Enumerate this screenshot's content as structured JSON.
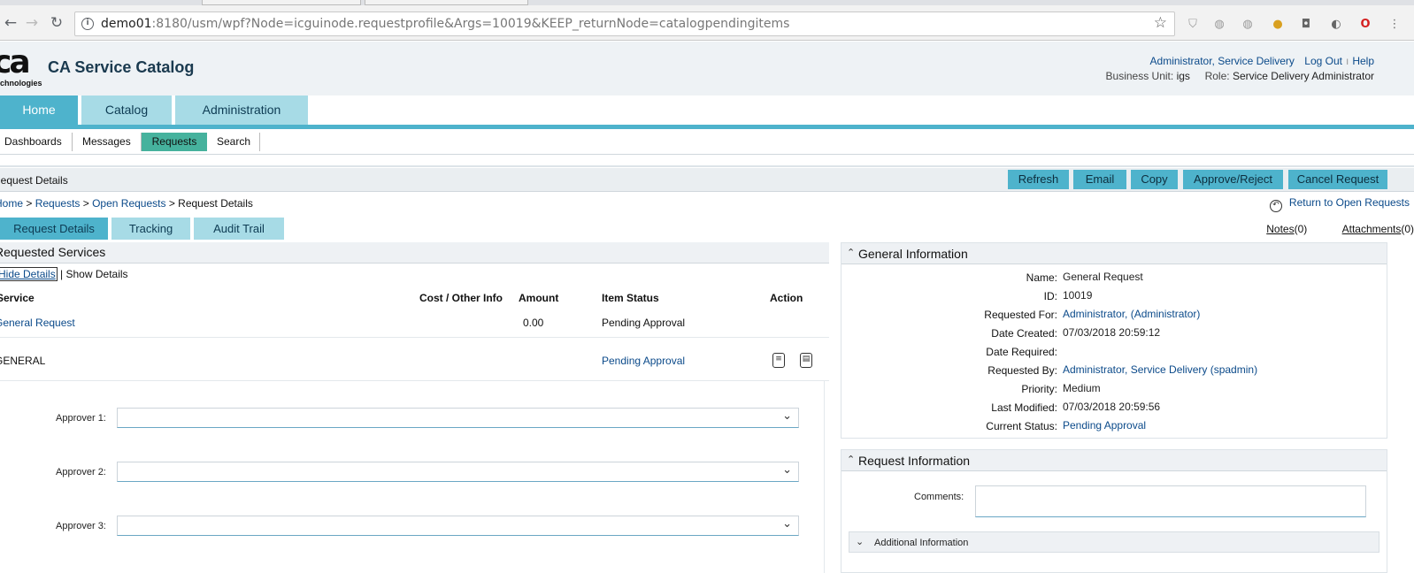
{
  "browser": {
    "url_host": "demo01",
    "url_rest": ":8180/usm/wpf?Node=icguinode.requestprofile&Args=10019&KEEP_returnNode=catalogpendingitems",
    "icons": [
      "back-icon",
      "forward-icon",
      "reload-icon",
      "info-icon",
      "star-icon"
    ]
  },
  "header": {
    "logo_text": "ca",
    "logo_sub": "technologies",
    "title": "CA Service Catalog",
    "user_link": "Administrator, Service Delivery",
    "logout": "Log Out",
    "help": "Help",
    "bu_label": "Business Unit:",
    "bu_value": "igs",
    "role_label": "Role:",
    "role_value": "Service Delivery Administrator"
  },
  "main_tabs": [
    "Home",
    "Catalog",
    "Administration"
  ],
  "subnav": [
    "Dashboards",
    "Messages",
    "Requests",
    "Search"
  ],
  "request_bar": {
    "title": "Request Details",
    "buttons": [
      "Refresh",
      "Email",
      "Copy",
      "Approve/Reject",
      "Cancel Request"
    ]
  },
  "breadcrumb": {
    "home": "Home",
    "requests": "Requests",
    "open": "Open Requests",
    "current": "Request Details",
    "sep": " > "
  },
  "return_link": "Return to Open Requests",
  "detail_tabs": [
    "Request Details",
    "Tracking",
    "Audit Trail"
  ],
  "notes": {
    "label": "Notes",
    "count": "(0)"
  },
  "attachments": {
    "label": "Attachments",
    "count": "(0)"
  },
  "requested_services": {
    "title": "Requested Services",
    "hide": "Hide Details",
    "sep": " | ",
    "show": "Show Details",
    "columns": {
      "service": "Service",
      "cost": "Cost / Other Info",
      "amount": "Amount",
      "status": "Item Status",
      "action": "Action"
    },
    "row": {
      "service": "General Request",
      "amount": "0.00",
      "status": "Pending Approval"
    },
    "sub_row": {
      "name": "GENERAL",
      "status": "Pending Approval"
    },
    "approvers": [
      "Approver 1:",
      "Approver 2:",
      "Approver 3:"
    ]
  },
  "general_info": {
    "title": "General Information",
    "fields": [
      {
        "label": "Name:",
        "value": "General Request"
      },
      {
        "label": "ID:",
        "value": "10019"
      },
      {
        "label": "Requested For:",
        "value": "Administrator,  (Administrator)"
      },
      {
        "label": "Date Created:",
        "value": "07/03/2018 20:59:12"
      },
      {
        "label": "Date Required:",
        "value": ""
      },
      {
        "label": "Requested By:",
        "value": "Administrator, Service Delivery (spadmin)"
      },
      {
        "label": "Priority:",
        "value": "Medium"
      },
      {
        "label": "Last Modified:",
        "value": "07/03/2018 20:59:56"
      },
      {
        "label": "Current Status:",
        "value": "Pending Approval"
      }
    ]
  },
  "request_info": {
    "title": "Request Information",
    "comments_label": "Comments:",
    "additional": "Additional Information"
  }
}
